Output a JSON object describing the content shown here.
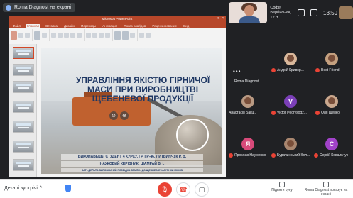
{
  "presenter": {
    "label": "Roma Diagnost на екрані"
  },
  "self_view": {
    "name": "Софія Вербиській, 12 ft"
  },
  "top_bar": {
    "time": "13:59"
  },
  "ppt": {
    "window_title": "Microsoft PowerPoint",
    "tabs": [
      "Файл",
      "Главная",
      "Вставка",
      "Дизайн",
      "Переходы",
      "Анимация",
      "Показ слайдов",
      "Рецензирование",
      "Вид"
    ],
    "slide_title": "УПРАВЛІННЯ ЯКІСТЮ ГІРНИЧОЇ МАСИ ПРИ ВИРОБНИЦТВІ ЩЕБЕНЕВОЇ ПРОДУКЦІЇ",
    "line1": "ВИКОНАВЕЦЬ: СТУДЕНТ 4 КУРСУ, ГР. ГР-46, ЛИТВИНЧУК Р. В.",
    "line2": "НАУКОВИЙ КЕРІВНИК: ШАМРАЙ В. І.",
    "line3": "ЗАТ «ДЕЛЬТА ВИРОБНИЧИЙ РОЗВІДКА ЗЕМЛИ» ДО ЩЕБНЕВОЇ КАМ'ЯНКИ ПІСКІВ"
  },
  "participants": [
    {
      "name": "Roma Diagnost",
      "type": "dots"
    },
    {
      "name": "Андрій Кривор...",
      "type": "photo"
    },
    {
      "name": "Best Friend",
      "type": "photo"
    },
    {
      "name": "Анастасія Бакц...",
      "type": "photo"
    },
    {
      "name": "Victor Podrysodz...",
      "type": "letter",
      "letter": "V",
      "color": "#7b3fb8"
    },
    {
      "name": "Оля Шевко",
      "type": "photo"
    },
    {
      "name": "Ярослав Науменко",
      "type": "letter",
      "letter": "Я",
      "color": "#d84a7a"
    },
    {
      "name": "Бурачинський Кол...",
      "type": "photo"
    },
    {
      "name": "Сергій Ковальчук",
      "type": "letter",
      "letter": "C",
      "color": "#a142c9"
    }
  ],
  "bottom": {
    "details": "Деталі зустрічі",
    "raise_hand": "Підняти руку",
    "presenting": "Roma Diagnost показує на екрані"
  }
}
